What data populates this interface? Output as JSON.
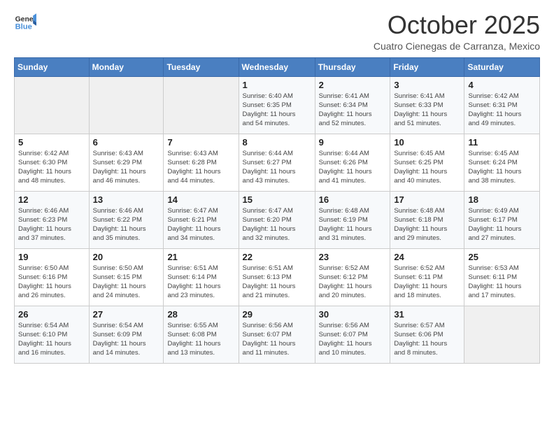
{
  "logo": {
    "line1": "General",
    "line2": "Blue"
  },
  "title": "October 2025",
  "location": "Cuatro Cienegas de Carranza, Mexico",
  "weekdays": [
    "Sunday",
    "Monday",
    "Tuesday",
    "Wednesday",
    "Thursday",
    "Friday",
    "Saturday"
  ],
  "weeks": [
    [
      {
        "day": "",
        "info": ""
      },
      {
        "day": "",
        "info": ""
      },
      {
        "day": "",
        "info": ""
      },
      {
        "day": "1",
        "info": "Sunrise: 6:40 AM\nSunset: 6:35 PM\nDaylight: 11 hours\nand 54 minutes."
      },
      {
        "day": "2",
        "info": "Sunrise: 6:41 AM\nSunset: 6:34 PM\nDaylight: 11 hours\nand 52 minutes."
      },
      {
        "day": "3",
        "info": "Sunrise: 6:41 AM\nSunset: 6:33 PM\nDaylight: 11 hours\nand 51 minutes."
      },
      {
        "day": "4",
        "info": "Sunrise: 6:42 AM\nSunset: 6:31 PM\nDaylight: 11 hours\nand 49 minutes."
      }
    ],
    [
      {
        "day": "5",
        "info": "Sunrise: 6:42 AM\nSunset: 6:30 PM\nDaylight: 11 hours\nand 48 minutes."
      },
      {
        "day": "6",
        "info": "Sunrise: 6:43 AM\nSunset: 6:29 PM\nDaylight: 11 hours\nand 46 minutes."
      },
      {
        "day": "7",
        "info": "Sunrise: 6:43 AM\nSunset: 6:28 PM\nDaylight: 11 hours\nand 44 minutes."
      },
      {
        "day": "8",
        "info": "Sunrise: 6:44 AM\nSunset: 6:27 PM\nDaylight: 11 hours\nand 43 minutes."
      },
      {
        "day": "9",
        "info": "Sunrise: 6:44 AM\nSunset: 6:26 PM\nDaylight: 11 hours\nand 41 minutes."
      },
      {
        "day": "10",
        "info": "Sunrise: 6:45 AM\nSunset: 6:25 PM\nDaylight: 11 hours\nand 40 minutes."
      },
      {
        "day": "11",
        "info": "Sunrise: 6:45 AM\nSunset: 6:24 PM\nDaylight: 11 hours\nand 38 minutes."
      }
    ],
    [
      {
        "day": "12",
        "info": "Sunrise: 6:46 AM\nSunset: 6:23 PM\nDaylight: 11 hours\nand 37 minutes."
      },
      {
        "day": "13",
        "info": "Sunrise: 6:46 AM\nSunset: 6:22 PM\nDaylight: 11 hours\nand 35 minutes."
      },
      {
        "day": "14",
        "info": "Sunrise: 6:47 AM\nSunset: 6:21 PM\nDaylight: 11 hours\nand 34 minutes."
      },
      {
        "day": "15",
        "info": "Sunrise: 6:47 AM\nSunset: 6:20 PM\nDaylight: 11 hours\nand 32 minutes."
      },
      {
        "day": "16",
        "info": "Sunrise: 6:48 AM\nSunset: 6:19 PM\nDaylight: 11 hours\nand 31 minutes."
      },
      {
        "day": "17",
        "info": "Sunrise: 6:48 AM\nSunset: 6:18 PM\nDaylight: 11 hours\nand 29 minutes."
      },
      {
        "day": "18",
        "info": "Sunrise: 6:49 AM\nSunset: 6:17 PM\nDaylight: 11 hours\nand 27 minutes."
      }
    ],
    [
      {
        "day": "19",
        "info": "Sunrise: 6:50 AM\nSunset: 6:16 PM\nDaylight: 11 hours\nand 26 minutes."
      },
      {
        "day": "20",
        "info": "Sunrise: 6:50 AM\nSunset: 6:15 PM\nDaylight: 11 hours\nand 24 minutes."
      },
      {
        "day": "21",
        "info": "Sunrise: 6:51 AM\nSunset: 6:14 PM\nDaylight: 11 hours\nand 23 minutes."
      },
      {
        "day": "22",
        "info": "Sunrise: 6:51 AM\nSunset: 6:13 PM\nDaylight: 11 hours\nand 21 minutes."
      },
      {
        "day": "23",
        "info": "Sunrise: 6:52 AM\nSunset: 6:12 PM\nDaylight: 11 hours\nand 20 minutes."
      },
      {
        "day": "24",
        "info": "Sunrise: 6:52 AM\nSunset: 6:11 PM\nDaylight: 11 hours\nand 18 minutes."
      },
      {
        "day": "25",
        "info": "Sunrise: 6:53 AM\nSunset: 6:11 PM\nDaylight: 11 hours\nand 17 minutes."
      }
    ],
    [
      {
        "day": "26",
        "info": "Sunrise: 6:54 AM\nSunset: 6:10 PM\nDaylight: 11 hours\nand 16 minutes."
      },
      {
        "day": "27",
        "info": "Sunrise: 6:54 AM\nSunset: 6:09 PM\nDaylight: 11 hours\nand 14 minutes."
      },
      {
        "day": "28",
        "info": "Sunrise: 6:55 AM\nSunset: 6:08 PM\nDaylight: 11 hours\nand 13 minutes."
      },
      {
        "day": "29",
        "info": "Sunrise: 6:56 AM\nSunset: 6:07 PM\nDaylight: 11 hours\nand 11 minutes."
      },
      {
        "day": "30",
        "info": "Sunrise: 6:56 AM\nSunset: 6:07 PM\nDaylight: 11 hours\nand 10 minutes."
      },
      {
        "day": "31",
        "info": "Sunrise: 6:57 AM\nSunset: 6:06 PM\nDaylight: 11 hours\nand 8 minutes."
      },
      {
        "day": "",
        "info": ""
      }
    ]
  ]
}
